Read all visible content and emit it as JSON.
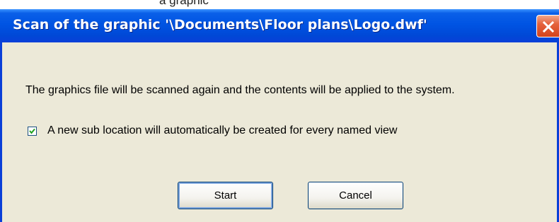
{
  "window": {
    "clipped_caption": "a graphic",
    "title": "Scan of the graphic '\\Documents\\Floor plans\\Logo.dwf'",
    "close_icon": "close-icon"
  },
  "dialog": {
    "message": "The graphics file will be scanned again and the contents will be applied to the system.",
    "checkbox": {
      "label": "A new sub location will automatically be created for every named view",
      "checked": true
    },
    "buttons": {
      "start_label": "Start",
      "cancel_label": "Cancel"
    }
  },
  "colors": {
    "titlebar": "#0054e3",
    "close_button": "#e5623c",
    "dialog_background": "#ece9d8",
    "button_border": "#003c74"
  }
}
